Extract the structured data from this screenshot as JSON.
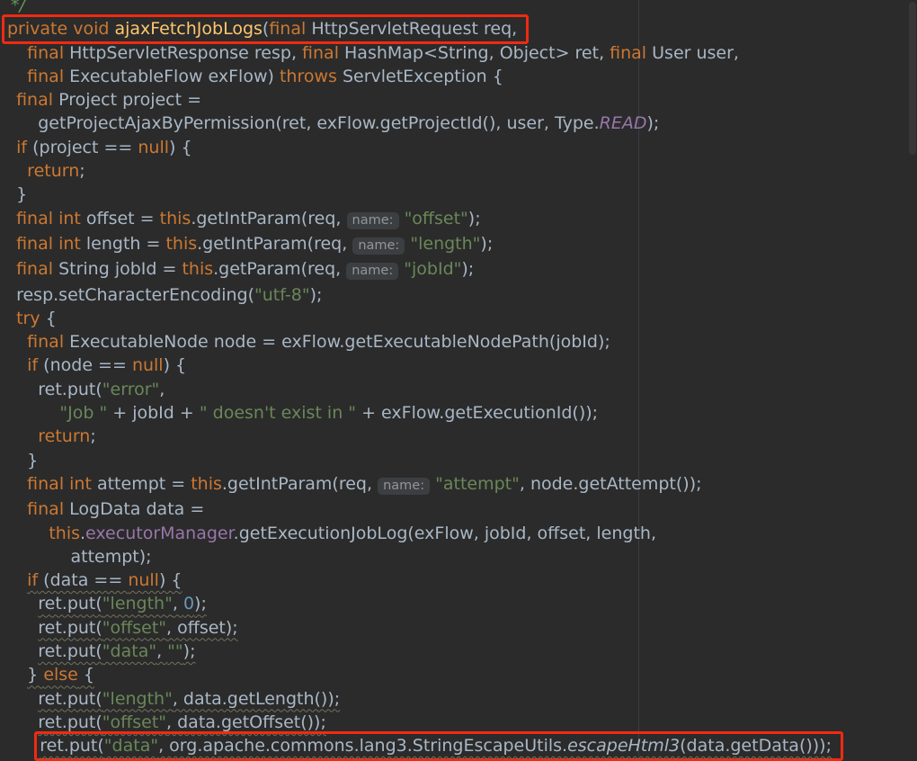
{
  "editor": {
    "palette": {
      "bg": "#2b2b2b",
      "fg": "#a9b7c6",
      "keyword": "#cc7832",
      "method-decl": "#ffc66d",
      "string": "#6a8759",
      "number": "#6897bb",
      "field": "#9876aa",
      "comment": "#629755",
      "hint-bg": "#3c3f42",
      "hint-fg": "#939598",
      "guide": "#3b3e40",
      "annotation": "#f02a12",
      "wavy": "#72725c"
    },
    "hint_label": "name:",
    "lines": [
      {
        "indent": 1,
        "tokens": [
          {
            "t": "*/",
            "c": "cm"
          }
        ]
      },
      {
        "indent": 0,
        "box": true,
        "tokens": [
          {
            "t": "private void ",
            "c": "k"
          },
          {
            "t": "ajaxFetchJobLogs",
            "c": "d"
          },
          {
            "t": "(",
            "c": "p"
          },
          {
            "t": "final",
            "c": "k"
          },
          {
            "t": " HttpServletRequest req,",
            "c": "p"
          }
        ]
      },
      {
        "indent": 4,
        "tokens": [
          {
            "t": "final",
            "c": "k"
          },
          {
            "t": " HttpServletResponse resp, ",
            "c": "p"
          },
          {
            "t": "final",
            "c": "k"
          },
          {
            "t": " HashMap<String, Object> ret, ",
            "c": "p"
          },
          {
            "t": "final",
            "c": "k"
          },
          {
            "t": " User user,",
            "c": "p"
          }
        ]
      },
      {
        "indent": 4,
        "tokens": [
          {
            "t": "final",
            "c": "k"
          },
          {
            "t": " ExecutableFlow exFlow) ",
            "c": "p"
          },
          {
            "t": "throws",
            "c": "k"
          },
          {
            "t": " ServletException {",
            "c": "p"
          }
        ]
      },
      {
        "indent": 2,
        "tokens": [
          {
            "t": "final",
            "c": "k"
          },
          {
            "t": " Project project =",
            "c": "p"
          }
        ]
      },
      {
        "indent": 6,
        "tokens": [
          {
            "t": "getProjectAjaxByPermission(ret, exFlow.getProjectId(), user, Type.",
            "c": "p"
          },
          {
            "t": "READ",
            "c": "fi"
          },
          {
            "t": ");",
            "c": "p"
          }
        ]
      },
      {
        "indent": 2,
        "tokens": [
          {
            "t": "if",
            "c": "k"
          },
          {
            "t": " (project == ",
            "c": "p"
          },
          {
            "t": "null",
            "c": "k"
          },
          {
            "t": ") {",
            "c": "p"
          }
        ]
      },
      {
        "indent": 4,
        "tokens": [
          {
            "t": "return",
            "c": "k"
          },
          {
            "t": ";",
            "c": "p"
          }
        ]
      },
      {
        "indent": 2,
        "tokens": [
          {
            "t": "}",
            "c": "p"
          }
        ]
      },
      {
        "indent": 2,
        "tokens": [
          {
            "t": "final int",
            "c": "k"
          },
          {
            "t": " offset = ",
            "c": "p"
          },
          {
            "t": "this",
            "c": "k"
          },
          {
            "t": ".getIntParam(req, ",
            "c": "p"
          },
          {
            "t": "name:",
            "c": "h"
          },
          {
            "t": " ",
            "c": "p"
          },
          {
            "t": "\"offset\"",
            "c": "s"
          },
          {
            "t": ");",
            "c": "p"
          }
        ]
      },
      {
        "indent": 2,
        "tokens": [
          {
            "t": "final int",
            "c": "k"
          },
          {
            "t": " length = ",
            "c": "p"
          },
          {
            "t": "this",
            "c": "k"
          },
          {
            "t": ".getIntParam(req, ",
            "c": "p"
          },
          {
            "t": "name:",
            "c": "h"
          },
          {
            "t": " ",
            "c": "p"
          },
          {
            "t": "\"length\"",
            "c": "s"
          },
          {
            "t": ");",
            "c": "p"
          }
        ]
      },
      {
        "indent": 2,
        "tokens": [
          {
            "t": "final",
            "c": "k"
          },
          {
            "t": " String jobId = ",
            "c": "p"
          },
          {
            "t": "this",
            "c": "k"
          },
          {
            "t": ".getParam(req, ",
            "c": "p"
          },
          {
            "t": "name:",
            "c": "h"
          },
          {
            "t": " ",
            "c": "p"
          },
          {
            "t": "\"jobId\"",
            "c": "s"
          },
          {
            "t": ");",
            "c": "p"
          }
        ]
      },
      {
        "indent": 2,
        "tokens": [
          {
            "t": "resp.setCharacterEncoding(",
            "c": "p"
          },
          {
            "t": "\"utf-8\"",
            "c": "s"
          },
          {
            "t": ");",
            "c": "p"
          }
        ]
      },
      {
        "indent": 2,
        "tokens": [
          {
            "t": "try",
            "c": "k"
          },
          {
            "t": " {",
            "c": "p"
          }
        ]
      },
      {
        "indent": 4,
        "tokens": [
          {
            "t": "final",
            "c": "k"
          },
          {
            "t": " ExecutableNode node = exFlow.getExecutableNodePath(jobId);",
            "c": "p"
          }
        ]
      },
      {
        "indent": 4,
        "tokens": [
          {
            "t": "if",
            "c": "k"
          },
          {
            "t": " (node == ",
            "c": "p"
          },
          {
            "t": "null",
            "c": "k"
          },
          {
            "t": ") {",
            "c": "p"
          }
        ]
      },
      {
        "indent": 6,
        "tokens": [
          {
            "t": "ret.put(",
            "c": "p"
          },
          {
            "t": "\"error\"",
            "c": "s"
          },
          {
            "t": ",",
            "c": "p"
          }
        ]
      },
      {
        "indent": 10,
        "tokens": [
          {
            "t": "\"Job \"",
            "c": "s"
          },
          {
            "t": " + jobId + ",
            "c": "p"
          },
          {
            "t": "\" doesn't exist in \"",
            "c": "s"
          },
          {
            "t": " + exFlow.getExecutionId());",
            "c": "p"
          }
        ]
      },
      {
        "indent": 6,
        "tokens": [
          {
            "t": "return",
            "c": "k"
          },
          {
            "t": ";",
            "c": "p"
          }
        ]
      },
      {
        "indent": 4,
        "tokens": [
          {
            "t": "}",
            "c": "p"
          }
        ]
      },
      {
        "indent": 4,
        "tokens": [
          {
            "t": "final int",
            "c": "k"
          },
          {
            "t": " attempt = ",
            "c": "p"
          },
          {
            "t": "this",
            "c": "k"
          },
          {
            "t": ".getIntParam(req, ",
            "c": "p"
          },
          {
            "t": "name:",
            "c": "h"
          },
          {
            "t": " ",
            "c": "p"
          },
          {
            "t": "\"attempt\"",
            "c": "s"
          },
          {
            "t": ", node.getAttempt());",
            "c": "p"
          }
        ]
      },
      {
        "indent": 4,
        "tokens": [
          {
            "t": "final",
            "c": "k"
          },
          {
            "t": " LogData data =",
            "c": "p"
          }
        ]
      },
      {
        "indent": 8,
        "tokens": [
          {
            "t": "this",
            "c": "k"
          },
          {
            "t": ".",
            "c": "p"
          },
          {
            "t": "executorManager",
            "c": "f"
          },
          {
            "t": ".getExecutionJobLog(exFlow, jobId, offset, length,",
            "c": "p"
          }
        ]
      },
      {
        "indent": 12,
        "tokens": [
          {
            "t": "attempt);",
            "c": "p"
          }
        ]
      },
      {
        "indent": 4,
        "u": true,
        "tokens": [
          {
            "t": "if",
            "c": "k"
          },
          {
            "t": " (data == ",
            "c": "p"
          },
          {
            "t": "null",
            "c": "k"
          },
          {
            "t": ") {",
            "c": "p"
          }
        ]
      },
      {
        "indent": 6,
        "u": true,
        "tokens": [
          {
            "t": "ret.put(",
            "c": "p"
          },
          {
            "t": "\"length\"",
            "c": "s"
          },
          {
            "t": ", ",
            "c": "p"
          },
          {
            "t": "0",
            "c": "n"
          },
          {
            "t": ");",
            "c": "p"
          }
        ]
      },
      {
        "indent": 6,
        "u": true,
        "tokens": [
          {
            "t": "ret.put(",
            "c": "p"
          },
          {
            "t": "\"offset\"",
            "c": "s"
          },
          {
            "t": ", offset);",
            "c": "p"
          }
        ]
      },
      {
        "indent": 6,
        "u": true,
        "tokens": [
          {
            "t": "ret.put(",
            "c": "p"
          },
          {
            "t": "\"data\"",
            "c": "s"
          },
          {
            "t": ", ",
            "c": "p"
          },
          {
            "t": "\"\"",
            "c": "s"
          },
          {
            "t": ");",
            "c": "p"
          }
        ]
      },
      {
        "indent": 4,
        "u": true,
        "tokens": [
          {
            "t": "} ",
            "c": "p"
          },
          {
            "t": "else",
            "c": "k"
          },
          {
            "t": " {",
            "c": "p"
          }
        ]
      },
      {
        "indent": 6,
        "u": true,
        "tokens": [
          {
            "t": "ret.put(",
            "c": "p"
          },
          {
            "t": "\"length\"",
            "c": "s"
          },
          {
            "t": ", data.getLength());",
            "c": "p"
          }
        ]
      },
      {
        "indent": 6,
        "u": true,
        "tokens": [
          {
            "t": "ret.put(",
            "c": "p"
          },
          {
            "t": "\"offset\"",
            "c": "s"
          },
          {
            "t": ", data.getOffset());",
            "c": "p"
          }
        ]
      },
      {
        "indent": 6,
        "u": true,
        "box": true,
        "tokens": [
          {
            "t": "ret.put(",
            "c": "p"
          },
          {
            "t": "\"data\"",
            "c": "s"
          },
          {
            "t": ", org.apache.commons.lang3.StringEscapeUtils.",
            "c": "p"
          },
          {
            "t": "escapeHtml3",
            "c": "mi"
          },
          {
            "t": "(data.getData()));",
            "c": "p"
          }
        ]
      }
    ]
  }
}
